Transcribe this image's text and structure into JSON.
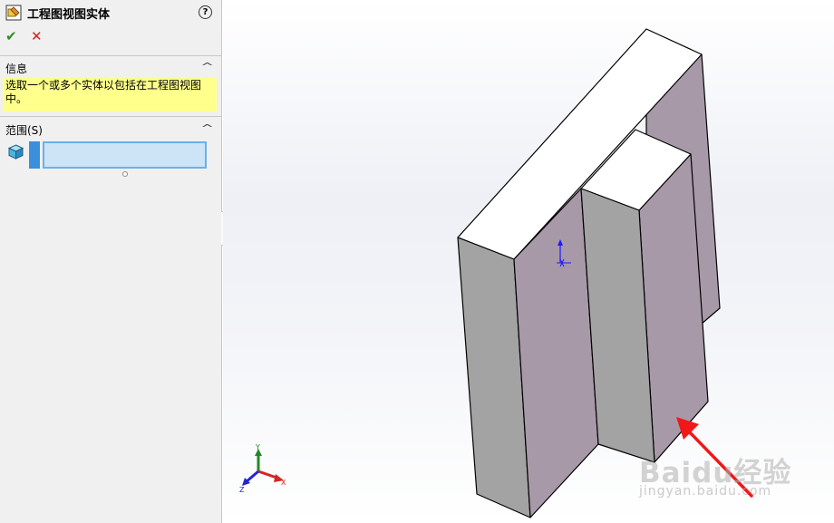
{
  "panel": {
    "title": "工程图视图实体",
    "help_glyph": "?",
    "ok_glyph": "✔",
    "cancel_glyph": "✕",
    "info_section": {
      "header": "信息",
      "message": "选取一个或多个实体以包括在工程图视图中。"
    },
    "scope_section": {
      "header": "范围(S)",
      "selection_value": ""
    }
  },
  "viewport": {
    "triad": {
      "x": "X",
      "y": "Y",
      "z": "Z"
    },
    "watermark": {
      "text": "Baidu经验",
      "url_text": "jingyan.baidu.com"
    }
  },
  "colors": {
    "accent": "#3b8fdc",
    "info_bg": "#ffff8c",
    "face_purple": "#a899a9",
    "face_gray": "#a3a3a3"
  }
}
